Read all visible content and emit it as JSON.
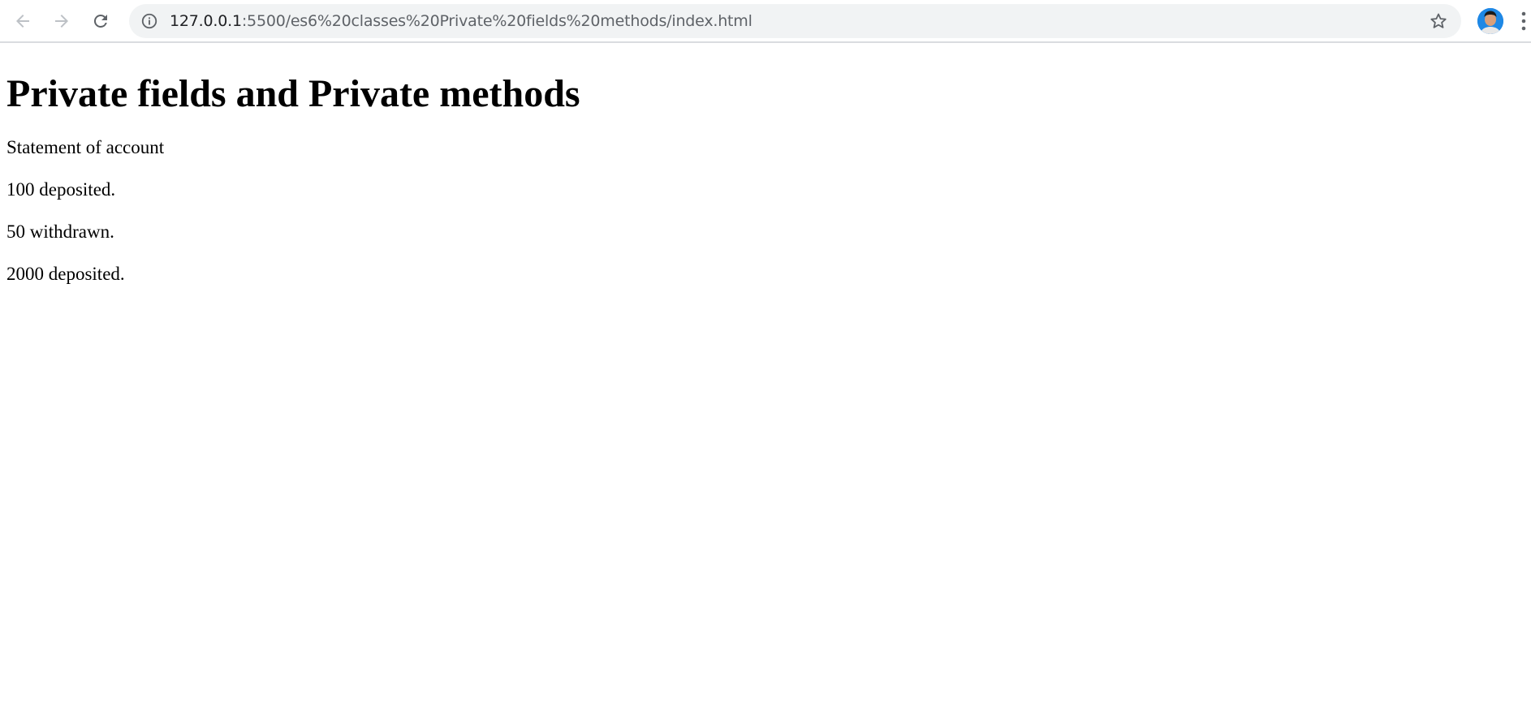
{
  "browser": {
    "url_host": "127.0.0.1",
    "url_path": ":5500/es6%20classes%20Private%20fields%20methods/index.html",
    "icons": {
      "back": "arrow-left-icon",
      "forward": "arrow-right-icon",
      "reload": "reload-icon",
      "info": "info-icon",
      "bookmark": "star-icon",
      "profile": "avatar",
      "menu": "kebab-menu-icon"
    }
  },
  "page": {
    "heading": "Private fields and Private methods",
    "lines": [
      "Statement of account",
      "100 deposited.",
      "50 withdrawn.",
      "2000 deposited."
    ]
  },
  "colors": {
    "toolbar_bg": "#ffffff",
    "omnibox_bg": "#f1f3f4",
    "icon_gray": "#5f6368",
    "text": "#000000"
  }
}
